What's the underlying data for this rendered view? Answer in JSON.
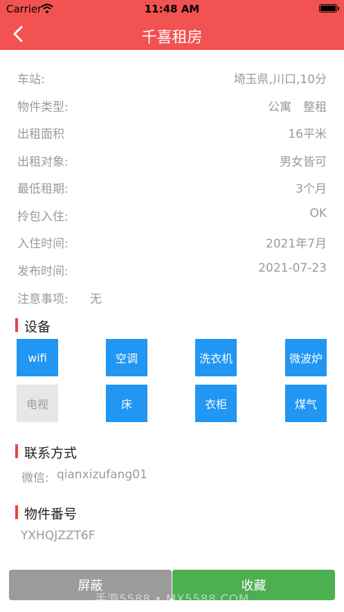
{
  "status_bar": {
    "carrier": "Carrier",
    "time": "11:48 AM"
  },
  "nav": {
    "title": "千喜租房"
  },
  "details": [
    {
      "label": "车站:",
      "value": "埼玉県,川口,10分"
    },
    {
      "label": "物件类型:",
      "value": "公寓　整租"
    },
    {
      "label": "出租面积",
      "value": "16平米"
    },
    {
      "label": "出租对象:",
      "value": "男女皆可"
    },
    {
      "label": "最低租期:",
      "value": "3个月"
    },
    {
      "label": "拎包入住:",
      "value": "OK"
    },
    {
      "label": "入住时间:",
      "value": "2021年7月"
    },
    {
      "label": "发布时间:",
      "value": "2021-07-23"
    }
  ],
  "notes": {
    "label": "注意事项:",
    "value": "无"
  },
  "equipment": {
    "title": "设备",
    "items": [
      {
        "label": "wifi",
        "enabled": true
      },
      {
        "label": "空调",
        "enabled": true
      },
      {
        "label": "洗衣机",
        "enabled": true
      },
      {
        "label": "微波炉",
        "enabled": true
      },
      {
        "label": "电视",
        "enabled": false
      },
      {
        "label": "床",
        "enabled": true
      },
      {
        "label": "衣柜",
        "enabled": true
      },
      {
        "label": "煤气",
        "enabled": true
      }
    ]
  },
  "contact": {
    "title": "联系方式",
    "wechat_label": "微信:",
    "wechat_id": "qianxizufang01"
  },
  "property_no": {
    "title": "物件番号",
    "value": "YXHQJZZT6F"
  },
  "actions": {
    "block_label": "屏蔽",
    "favorite_label": "收藏"
  },
  "watermark": "手游5588 • MX5588.COM",
  "colors": {
    "header": "#f25252",
    "tag_on": "#2196f3",
    "tag_off": "#e6e6e6",
    "favorite": "#4caf50",
    "block": "#9b9b9b"
  }
}
